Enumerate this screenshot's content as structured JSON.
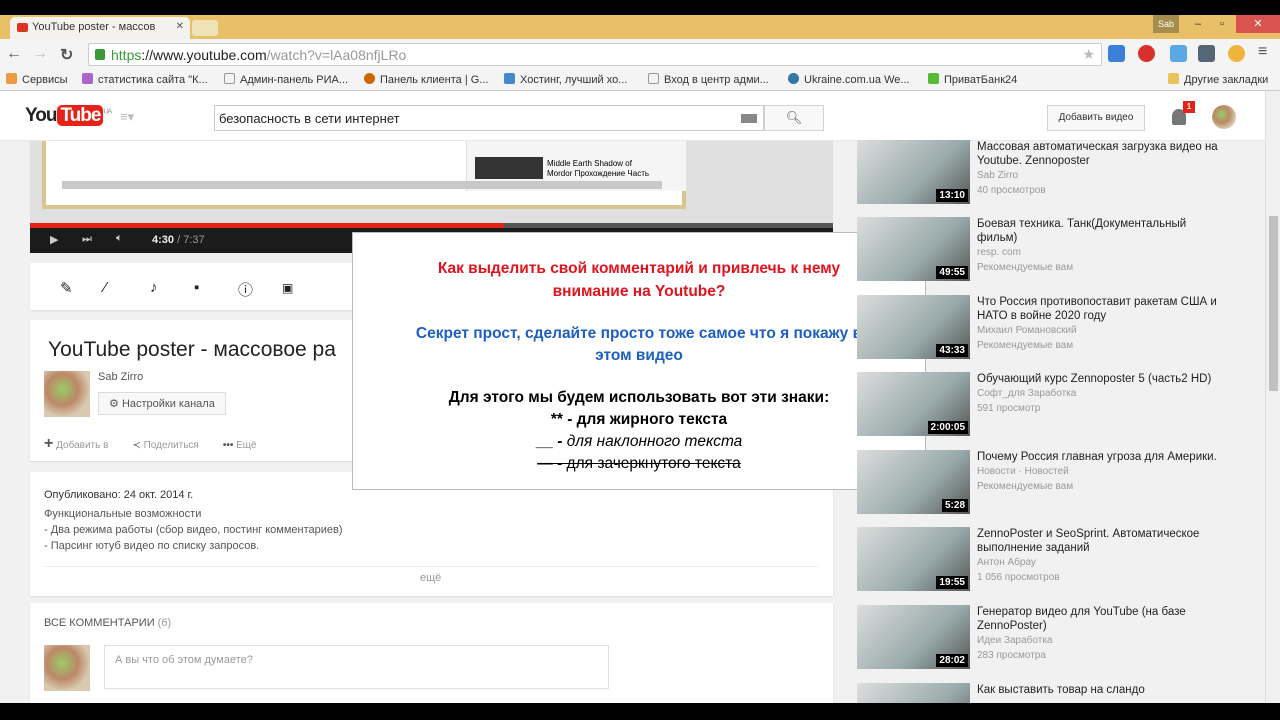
{
  "browser": {
    "tab_title": "YouTube poster - массов",
    "url_scheme": "https",
    "url_host": "://www.youtube.com",
    "url_path": "/watch?v=lAa08nfjLRo",
    "bookmarks": [
      "Сервисы",
      "статистика сайта \"К...",
      "Админ-панель РИА...",
      "Панель клиента | G...",
      "Хостинг, лучший хо...",
      "Вход в центр адми...",
      "Ukraine.com.ua We...",
      "ПриватБанк24"
    ],
    "other_bookmarks": "Другие закладки",
    "user_chip": "Sab"
  },
  "header": {
    "logo_you": "You",
    "logo_tube": "Tube",
    "logo_region": "UA",
    "search_value": "безопасность в сети интернет",
    "upload": "Добавить видео",
    "notifications": "1"
  },
  "player": {
    "time_current": "4:30",
    "time_total": "/ 7:37",
    "progress": 0.59,
    "embedded_text": [
      "Middle Earth Shadow of",
      "Mordor Прохождение Часть"
    ]
  },
  "video": {
    "title": "YouTube poster - массовое ра",
    "channel": "Sab Zirro",
    "channel_settings": "Настройки канала",
    "add_to": "Добавить в",
    "share": "Поделиться",
    "more": "Ещё"
  },
  "description": {
    "published": "Опубликовано: 24 окт. 2014 г.",
    "lines": [
      "Функциональные возможности",
      "- Два режима работы (сбор видео, постинг комментариев)",
      "- Парсинг ютуб видео по списку запросов."
    ],
    "more": "ещё"
  },
  "comments": {
    "header": "ВСЕ КОММЕНТАРИИ",
    "count": "(6)",
    "placeholder": "А вы что об этом думаете?"
  },
  "overlay": {
    "red": [
      "Как выделить свой комментарий и привлечь к нему",
      "внимание на Youtube?"
    ],
    "blue": [
      "Секрет прост, сделайте просто тоже самое что я покажу в",
      "этом видео"
    ],
    "black_title": "Для этого мы будем использовать вот эти знаки:",
    "bold_line": "** - для жирного текста",
    "italic_mark": "__ -",
    "italic_text": " для наклонного текста",
    "strike_mark": "— - ",
    "strike_text": "для зачеркнутого текста"
  },
  "sidebar": [
    {
      "title": "Массовая автоматическая загрузка видео на Youtube. Zennoposter",
      "channel": "Sab Zirro",
      "meta": "40 просмотров",
      "duration": "13:10"
    },
    {
      "title": "Боевая техника. Танк(Документальный фильм)",
      "channel": "resp. com",
      "meta": "Рекомендуемые вам",
      "duration": "49:55"
    },
    {
      "title": "Что Россия противопоставит ракетам США и НАТО в войне 2020 году",
      "channel": "Михаил Романовский",
      "meta": "Рекомендуемые вам",
      "duration": "43:33"
    },
    {
      "title": "Обучающий курс Zennoposter 5 (часть2 HD)",
      "channel": "Софт_для Заработка",
      "meta": "591 просмотр",
      "duration": "2:00:05"
    },
    {
      "title": "Почему Россия главная угроза для Америки.",
      "channel": "Новости · Новостей",
      "meta": "Рекомендуемые вам",
      "duration": "5:28"
    },
    {
      "title": "ZennoPoster и SeoSprint. Автоматическое выполнение заданий",
      "channel": "Антон Абрау",
      "meta": "1 056 просмотров",
      "duration": "19:55"
    },
    {
      "title": "Генератор видео для YouTube (на базе ZennoPoster)",
      "channel": "Идеи Заработка",
      "meta": "283 просмотра",
      "duration": "28:02"
    },
    {
      "title": "Как выставить товар на сландо",
      "channel": "",
      "meta": "",
      "duration": ""
    }
  ]
}
